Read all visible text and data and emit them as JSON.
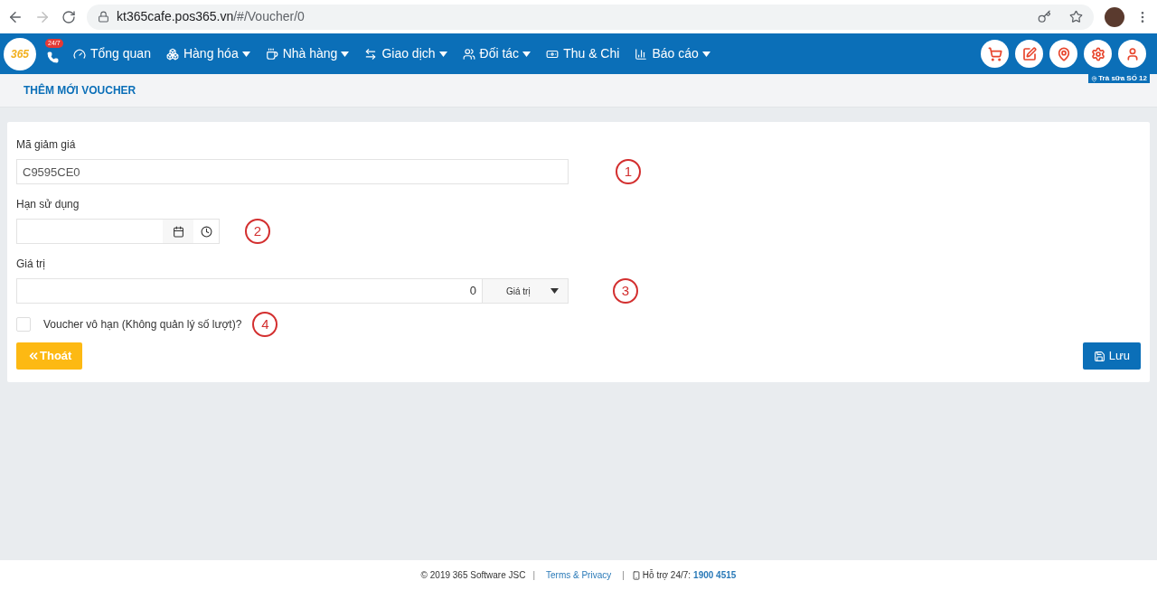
{
  "browser": {
    "url_host": "kt365cafe.pos365.vn",
    "url_path": "/#/Voucher/0"
  },
  "nav": {
    "logo": "365",
    "hotline_badge": "24/7",
    "items": [
      {
        "label": "Tổng quan",
        "dropdown": false
      },
      {
        "label": "Hàng hóa",
        "dropdown": true
      },
      {
        "label": "Nhà hàng",
        "dropdown": true
      },
      {
        "label": "Giao dịch",
        "dropdown": true
      },
      {
        "label": "Đối tác",
        "dropdown": true
      },
      {
        "label": "Thu & Chi",
        "dropdown": false
      },
      {
        "label": "Báo cáo",
        "dropdown": true
      }
    ],
    "branch": "Trà sữa SỐ 12"
  },
  "page_title": "THÊM MỚI VOUCHER",
  "form": {
    "code_label": "Mã giảm giá",
    "code_value": "C9595CE0",
    "expiry_label": "Hạn sử dụng",
    "value_label": "Giá trị",
    "value": "0",
    "value_type": "Giá trị",
    "unlimited_label": "Voucher vô hạn (Không quản lý số lượt)?",
    "unlimited_checked": false,
    "exit_button": "Thoát",
    "save_button": "Lưu"
  },
  "annotations": [
    "1",
    "2",
    "3",
    "4"
  ],
  "footer": {
    "copyright": "© 2019 365 Software JSC",
    "separator_1": "|",
    "terms": "Terms & Privacy",
    "separator_2": "|",
    "support": "Hỗ trợ 24/7:",
    "phone": "1900 4515"
  }
}
